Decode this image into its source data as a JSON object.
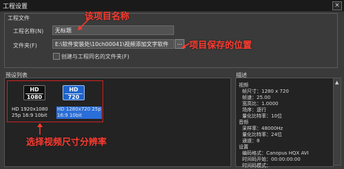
{
  "window": {
    "title": "工程设置",
    "close_label": "×"
  },
  "project_file": {
    "group_title": "工程文件",
    "name_label": "工程名称(N)",
    "name_value": "无标题",
    "folder_label": "文件夹(F)",
    "folder_value": "E:\\软件安装处\\10ch00041\\视频添加文字软件",
    "browse_label": "...",
    "checkbox_label": "创建与工程同名的文件夹(F)"
  },
  "annotations": {
    "name": "该项目名称",
    "folder": "项目保存的位置",
    "presets": "选择视频尺寸分辨率"
  },
  "presets": {
    "label": "预设列表",
    "items": [
      {
        "badge_top": "HD",
        "badge_bottom": "1080",
        "line1": "HD 1920x1080",
        "line2": "25p 16:9 10bit",
        "selected": false
      },
      {
        "badge_top": "HD",
        "badge_bottom": "720",
        "line1": "HD 1280x720 25p",
        "line2": "16:9 10bit",
        "selected": true
      }
    ]
  },
  "description": {
    "label": "描述",
    "lines": [
      "视频",
      "帧尺寸：1280 x 720",
      "帧速：25.00",
      "宽高比：1.0000",
      "场序：逐行",
      "量化比特率：10位",
      "音频",
      "采样率：48000Hz",
      "量化比特率：24位",
      "通道：8",
      "设置",
      "编码格式：Canopus HQX AVI",
      "时间码开始：00:00:00:00",
      "时间码模式："
    ]
  },
  "colors": {
    "annotation": "#ff3b30",
    "selection": "#2a6ed8",
    "highlight_border": "#d42020"
  }
}
